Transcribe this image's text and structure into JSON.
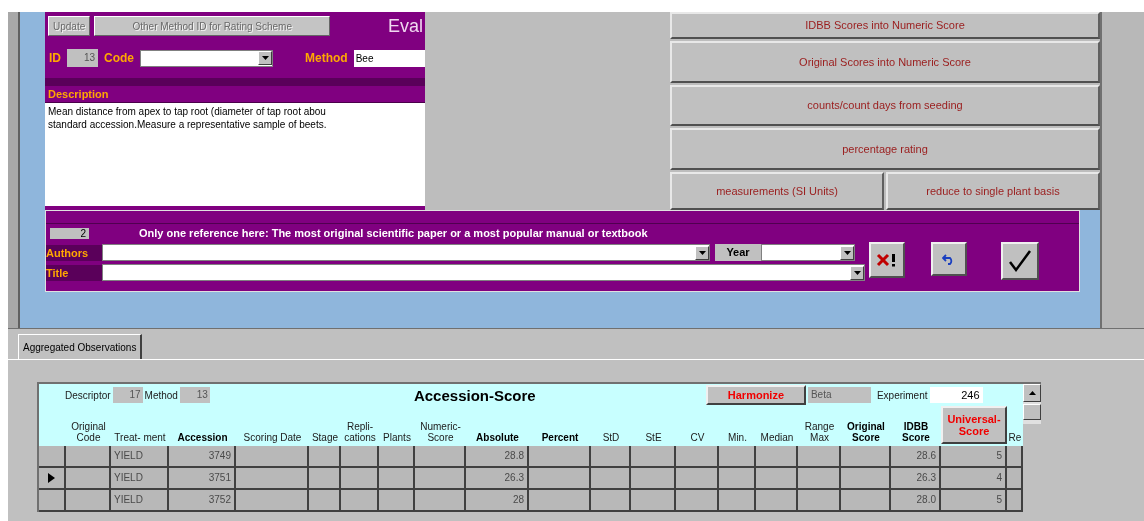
{
  "form": {
    "buttons": [
      {
        "label": "Update"
      },
      {
        "label": "Other Method ID for Rating Scheme"
      }
    ],
    "title": "Eval",
    "id_label": "ID",
    "id": "13",
    "code_label": "Code",
    "method_label": "Method",
    "method": "Bee",
    "description_label": "Description",
    "description_lines": [
      "Mean distance from apex to tap root (diameter of tap root abou",
      "standard accession.Measure a representative sample of beets."
    ]
  },
  "conversion_buttons": [
    {
      "label": "IDBB Scores into Numeric Score",
      "kind": "full"
    },
    {
      "label": "Original Scores into Numeric Score",
      "kind": "full"
    },
    {
      "label": "counts/count days from seeding",
      "kind": "full"
    },
    {
      "label": "percentage rating",
      "kind": "full"
    },
    {
      "label": "measurements (SI Units)",
      "kind": "half"
    },
    {
      "label": "reduce to single plant basis",
      "kind": "half"
    }
  ],
  "reference": {
    "number": "2",
    "note": "Only one reference here: The most original scientific paper or a most popular manual or textbook",
    "authors_label": "Authors",
    "year_label": "Year",
    "title_label": "Title"
  },
  "tabs": [
    {
      "label": "Aggregated Observations",
      "selected": true
    }
  ],
  "subform": {
    "descriptor_label": "Descriptor",
    "descriptor": "17",
    "method_label": "Method",
    "method": "13",
    "title": "Accession-Score",
    "harmonize": "Harmonize",
    "beta": "Beta",
    "experiment_label": "Experiment",
    "experiment": "246"
  },
  "columns": [
    {
      "label": "Original Code",
      "kind": "plain"
    },
    {
      "label": "Treat- ment",
      "kind": "plain"
    },
    {
      "label": "Accession",
      "kind": "bold"
    },
    {
      "label": "Scoring Date",
      "kind": "plain"
    },
    {
      "label": "Stage",
      "kind": "plain"
    },
    {
      "label": "Repli- cations",
      "kind": "plain"
    },
    {
      "label": "Plants",
      "kind": "plain"
    },
    {
      "label": "Numeric- Score",
      "kind": "plain"
    },
    {
      "label": "Absolute",
      "kind": "bold"
    },
    {
      "label": "Percent",
      "kind": "bold"
    },
    {
      "label": "StD",
      "kind": "plain"
    },
    {
      "label": "StE",
      "kind": "plain"
    },
    {
      "label": "CV",
      "kind": "plain"
    },
    {
      "label": "Min.",
      "kind": "plain"
    },
    {
      "label": "Median",
      "kind": "plain"
    },
    {
      "label": "Range Max",
      "kind": "plain"
    },
    {
      "label": "Original Score",
      "kind": "bold"
    },
    {
      "label": "IDBB Score",
      "kind": "bold"
    },
    {
      "label": "Universal- Score",
      "kind": "button"
    },
    {
      "label": "Re",
      "kind": "plain"
    }
  ],
  "rows": [
    {
      "selected": false,
      "treatment": "YIELD",
      "accession": "3749",
      "absolute": "28.8",
      "idbb_score": "28.6",
      "universal_score": "5"
    },
    {
      "selected": true,
      "treatment": "YIELD",
      "accession": "3751",
      "absolute": "26.3",
      "idbb_score": "26.3",
      "universal_score": "4"
    },
    {
      "selected": false,
      "treatment": "YIELD",
      "accession": "3752",
      "absolute": "28",
      "idbb_score": "28.0",
      "universal_score": "5"
    }
  ]
}
